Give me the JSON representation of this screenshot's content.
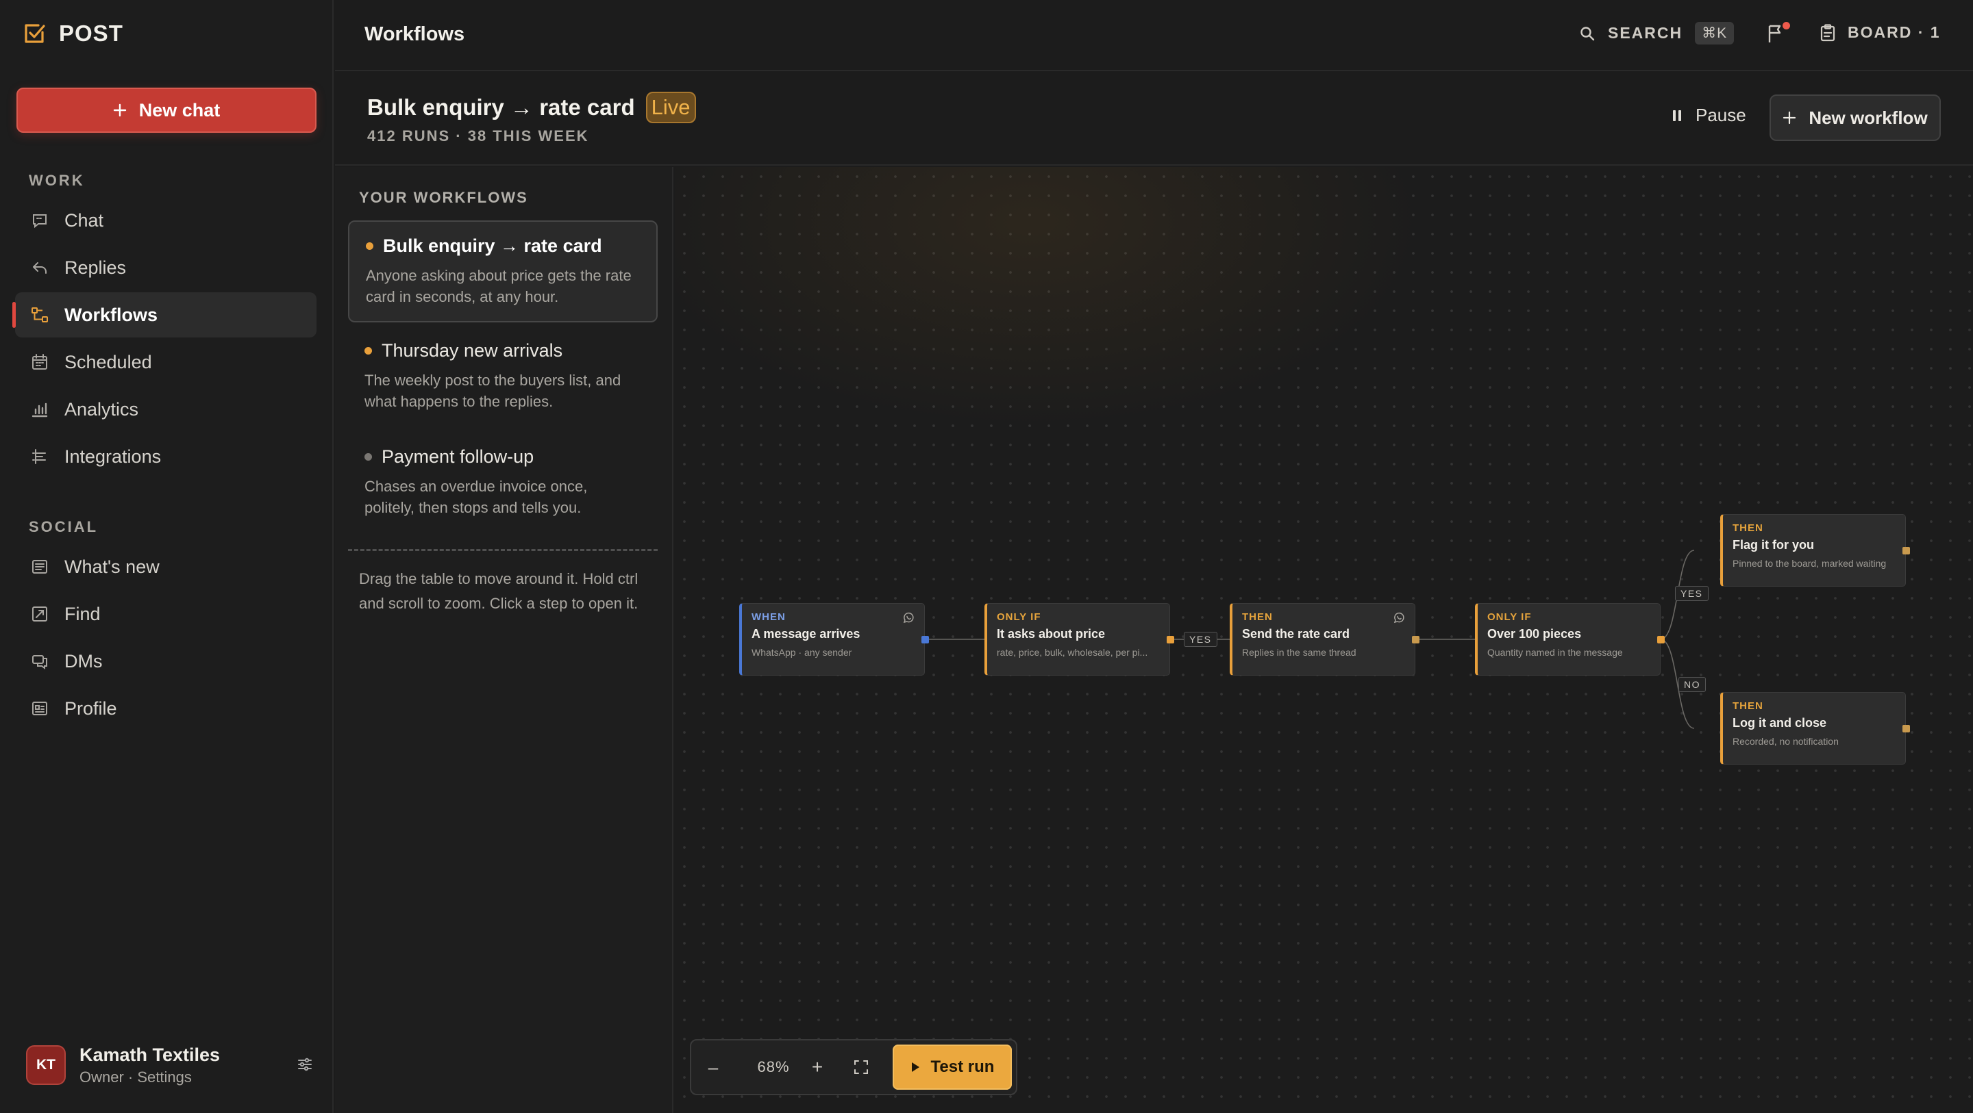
{
  "app": {
    "logo_text": "POST"
  },
  "sidebar": {
    "new_chat_label": "New chat",
    "sections": {
      "work": "WORK",
      "social": "SOCIAL"
    },
    "work_items": [
      {
        "label": "Chat",
        "icon": "chat-icon"
      },
      {
        "label": "Replies",
        "icon": "reply-icon"
      },
      {
        "label": "Workflows",
        "icon": "workflow-icon",
        "active": true
      },
      {
        "label": "Scheduled",
        "icon": "calendar-icon"
      },
      {
        "label": "Analytics",
        "icon": "bar-chart-icon"
      },
      {
        "label": "Integrations",
        "icon": "integrations-icon"
      }
    ],
    "social_items": [
      {
        "label": "What's new",
        "icon": "news-icon"
      },
      {
        "label": "Find",
        "icon": "find-icon"
      },
      {
        "label": "DMs",
        "icon": "dm-icon"
      },
      {
        "label": "Profile",
        "icon": "profile-icon"
      }
    ],
    "user": {
      "initials": "KT",
      "name": "Kamath Textiles",
      "subtitle": "Owner · Settings"
    }
  },
  "topbar": {
    "title": "Workflows",
    "search_label": "SEARCH",
    "search_shortcut": "⌘K",
    "board_label": "BOARD · 1"
  },
  "workflow": {
    "title": "Bulk enquiry → rate card",
    "status_badge": "Live",
    "meta": "412 RUNS · 38 THIS WEEK",
    "pause_label": "Pause",
    "new_workflow_label": "New workflow"
  },
  "workflow_list": {
    "heading": "YOUR WORKFLOWS",
    "items": [
      {
        "title": "Bulk enquiry → rate card",
        "description": "Anyone asking about price gets the rate card in seconds, at any hour.",
        "status_color": "#e9a03b",
        "active": true
      },
      {
        "title": "Thursday new arrivals",
        "description": "The weekly post to the buyers list, and what happens to the replies.",
        "status_color": "#e9a03b"
      },
      {
        "title": "Payment follow-up",
        "description": "Chases an overdue invoice once, politely, then stops and tells you.",
        "status_color": "#7a7773"
      }
    ],
    "hint": "Drag the table to move around it. Hold ctrl and scroll to zoom. Click a step to open it."
  },
  "canvas": {
    "nodes": [
      {
        "kind": "WHEN",
        "title": "A message arrives",
        "subtitle": "WhatsApp · any sender",
        "icon": "whatsapp-icon"
      },
      {
        "kind": "ONLY IF",
        "title": "It asks about price",
        "subtitle": "rate, price, bulk, wholesale, per pi..."
      },
      {
        "kind": "THEN",
        "title": "Send the rate card",
        "subtitle": "Replies in the same thread",
        "icon": "whatsapp-icon"
      },
      {
        "kind": "ONLY IF",
        "title": "Over 100 pieces",
        "subtitle": "Quantity named in the message"
      },
      {
        "kind": "THEN",
        "title": "Flag it for you",
        "subtitle": "Pinned to the board, marked waiting"
      },
      {
        "kind": "THEN",
        "title": "Log it and close",
        "subtitle": "Recorded, no notification"
      }
    ],
    "edge_labels": {
      "yes_1": "YES",
      "yes_2": "YES",
      "no": "NO"
    },
    "colors": {
      "accent": "#e9a03b",
      "trigger": "#4a78d6",
      "danger": "#c43b33"
    }
  },
  "toolbar": {
    "zoom_out": "–",
    "zoom_level": "68%",
    "zoom_in": "+",
    "test_run_label": "Test run"
  }
}
